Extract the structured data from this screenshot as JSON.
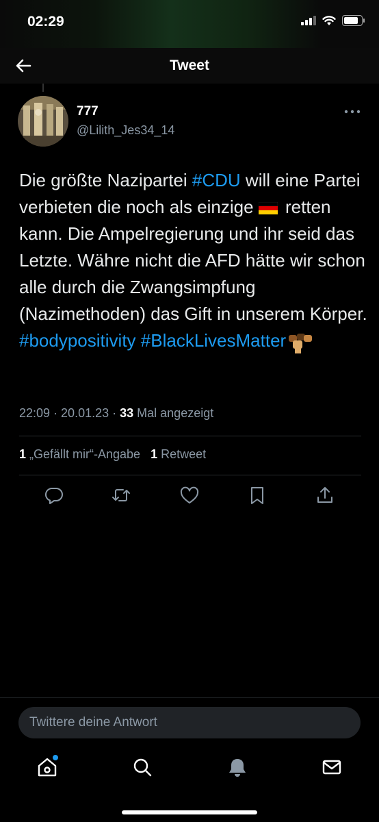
{
  "status_bar": {
    "time": "02:29"
  },
  "header": {
    "title": "Tweet"
  },
  "author": {
    "display_name": "777",
    "handle": "@Lilith_Jes34_14"
  },
  "tweet": {
    "seg1": "Die größte Nazipartei ",
    "hashtag_cdu": "#CDU",
    "seg2": "  will eine Partei verbieten die noch als einzige ",
    "flag_icon": "germany-flag-emoji",
    "seg3": " retten kann. Die Ampelregierung und ihr seid das Letzte. Währe nicht die AFD hätte wir schon alle durch die Zwangsimpfung (Nazimethoden) das Gift in unserem Körper. ",
    "hashtag_body": "#bodypositivity",
    "hashtag_blm": "#BlackLivesMatter",
    "emoji_icon": "raised-fists-emoji"
  },
  "meta": {
    "time": "22:09",
    "sep": " · ",
    "date": "20.01.23",
    "views_count": "33",
    "views_label": " Mal angezeigt"
  },
  "stats": {
    "likes_count": "1",
    "likes_label": " „Gefällt mir“-Angabe",
    "retweets_count": "1",
    "retweets_label": " Retweet"
  },
  "actions": [
    "reply-icon",
    "retweet-icon",
    "like-icon",
    "bookmark-icon",
    "share-icon"
  ],
  "reply": {
    "placeholder": "Twittere deine Antwort"
  },
  "tabbar": [
    "home-icon",
    "search-icon",
    "notifications-icon",
    "messages-icon"
  ],
  "colors": {
    "accent": "#1d9bf0",
    "background": "#000000",
    "secondary_text": "#8b98a5"
  }
}
